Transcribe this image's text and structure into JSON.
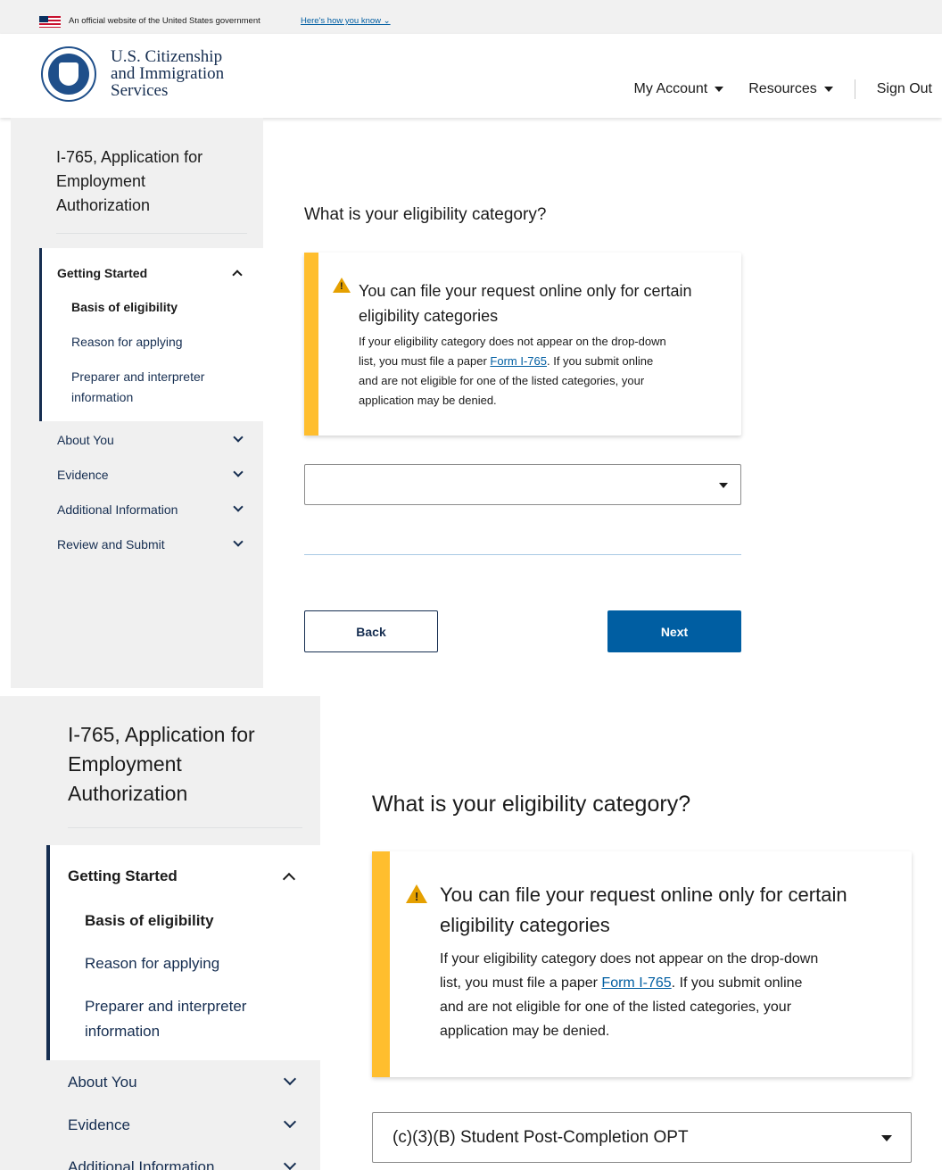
{
  "banner": {
    "text": "An official website of the United States government",
    "link": "Here's how you know"
  },
  "header": {
    "agency_line1": "U.S. Citizenship",
    "agency_line2": "and Immigration",
    "agency_line3": "Services",
    "nav": {
      "my_account": "My Account",
      "resources": "Resources",
      "sign_out": "Sign Out"
    }
  },
  "sidebar": {
    "title_line1": "I-765, Application for",
    "title_line2": "Employment",
    "title_line3": "Authorization",
    "getting_started": "Getting Started",
    "basis": "Basis of eligibility",
    "reason": "Reason for applying",
    "preparer_line1": "Preparer and interpreter",
    "preparer_line2": "information",
    "about_you": "About You",
    "evidence": "Evidence",
    "additional": "Additional Information",
    "review": "Review and Submit"
  },
  "main": {
    "question": "What is your eligibility category?",
    "alert": {
      "heading_line1": "You can file your request online only for certain",
      "heading_line2": "eligibility categories",
      "body_line1": "If your eligibility category does not appear on the drop-down",
      "body_line2_pre": "list, you must file a paper ",
      "body_link": "Form I-765",
      "body_line2_post": ". If you submit online",
      "body_line3": "and are not eligible for one of the listed categories, your",
      "body_line4": "application may be denied."
    },
    "select_value_empty": "",
    "select_value_selected": "(c)(3)(B) Student Post-Completion OPT",
    "back_label": "Back",
    "next_label": "Next"
  },
  "icons": {
    "warning": "warning-icon",
    "chevron_up": "chevron-up-icon",
    "chevron_down": "chevron-down-icon",
    "caret": "caret-down-icon"
  },
  "colors": {
    "navy": "#162e51",
    "link_blue": "#005ea2",
    "warning_yellow": "#ffbe2e",
    "sidebar_gray": "#f0f0f0"
  }
}
